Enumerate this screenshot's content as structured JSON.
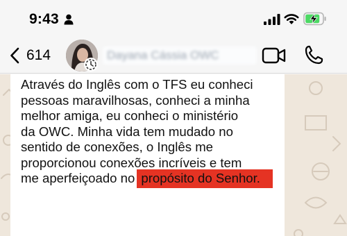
{
  "status_bar": {
    "time": "9:43",
    "icons": [
      "person-icon",
      "signal-icon",
      "wifi-icon",
      "battery-charging-icon"
    ],
    "battery_color": "#4cd964"
  },
  "header": {
    "back_count": "614",
    "contact_name": "Dayana Cássia OWC",
    "icons": [
      "chevron-left-icon",
      "video-camera-icon",
      "phone-icon"
    ]
  },
  "message": {
    "text_main": "Através do Inglês com o TFS eu conheci\npessoas maravilhosas, conheci a minha\nmelhor amiga, eu conheci o ministério\nda OWC. Minha vida tem mudado no\nsentido de conexões, o Inglês me\nproporcionou conexões incríveis e tem\nme aperfeiçoado no",
    "text_highlighted": "propósito do Senhor.",
    "highlight_color": "#e53323"
  },
  "colors": {
    "chat_background": "#efe7dc",
    "bubble": "#ffffff"
  }
}
